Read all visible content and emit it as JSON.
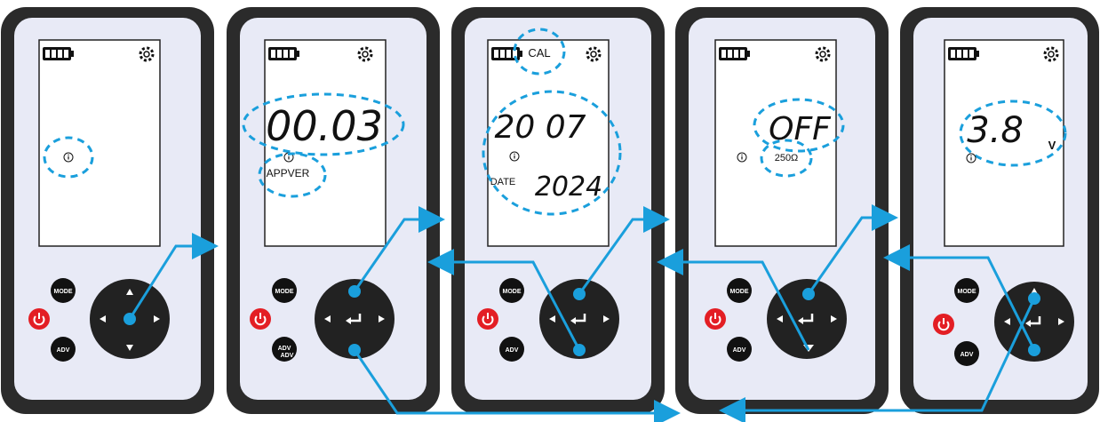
{
  "buttons": {
    "mode_label": "MODE",
    "adv_label": "ADV",
    "adv_label_overlap": "ADV"
  },
  "icons": {
    "battery": "battery-full-icon",
    "settings": "gear-icon",
    "info": "info-icon",
    "power": "power-icon",
    "arrow_up": "arrow-up-icon",
    "arrow_down": "arrow-down-icon",
    "arrow_left": "arrow-left-icon",
    "arrow_right": "arrow-right-icon",
    "enter": "enter-icon"
  },
  "colors": {
    "device_body": "#2b2b2b",
    "device_face": "#e8eaf6",
    "screen_bg": "#ffffff",
    "power_red": "#e31e24",
    "highlight_blue": "#1a9fdc",
    "arrow_blue": "#1a9fdc"
  },
  "screens": [
    {
      "id": "screen-1",
      "main_value": "",
      "sub_label": ""
    },
    {
      "id": "screen-2",
      "main_value": "00.03",
      "sub_label": "APPVER"
    },
    {
      "id": "screen-3",
      "top_label": "CAL",
      "main_value": "20 07",
      "date_label": "DATE",
      "year_value": "2024"
    },
    {
      "id": "screen-4",
      "main_value": "OFF",
      "sub_label": "250Ω"
    },
    {
      "id": "screen-5",
      "main_value": "3.8",
      "unit_label": "V"
    }
  ]
}
